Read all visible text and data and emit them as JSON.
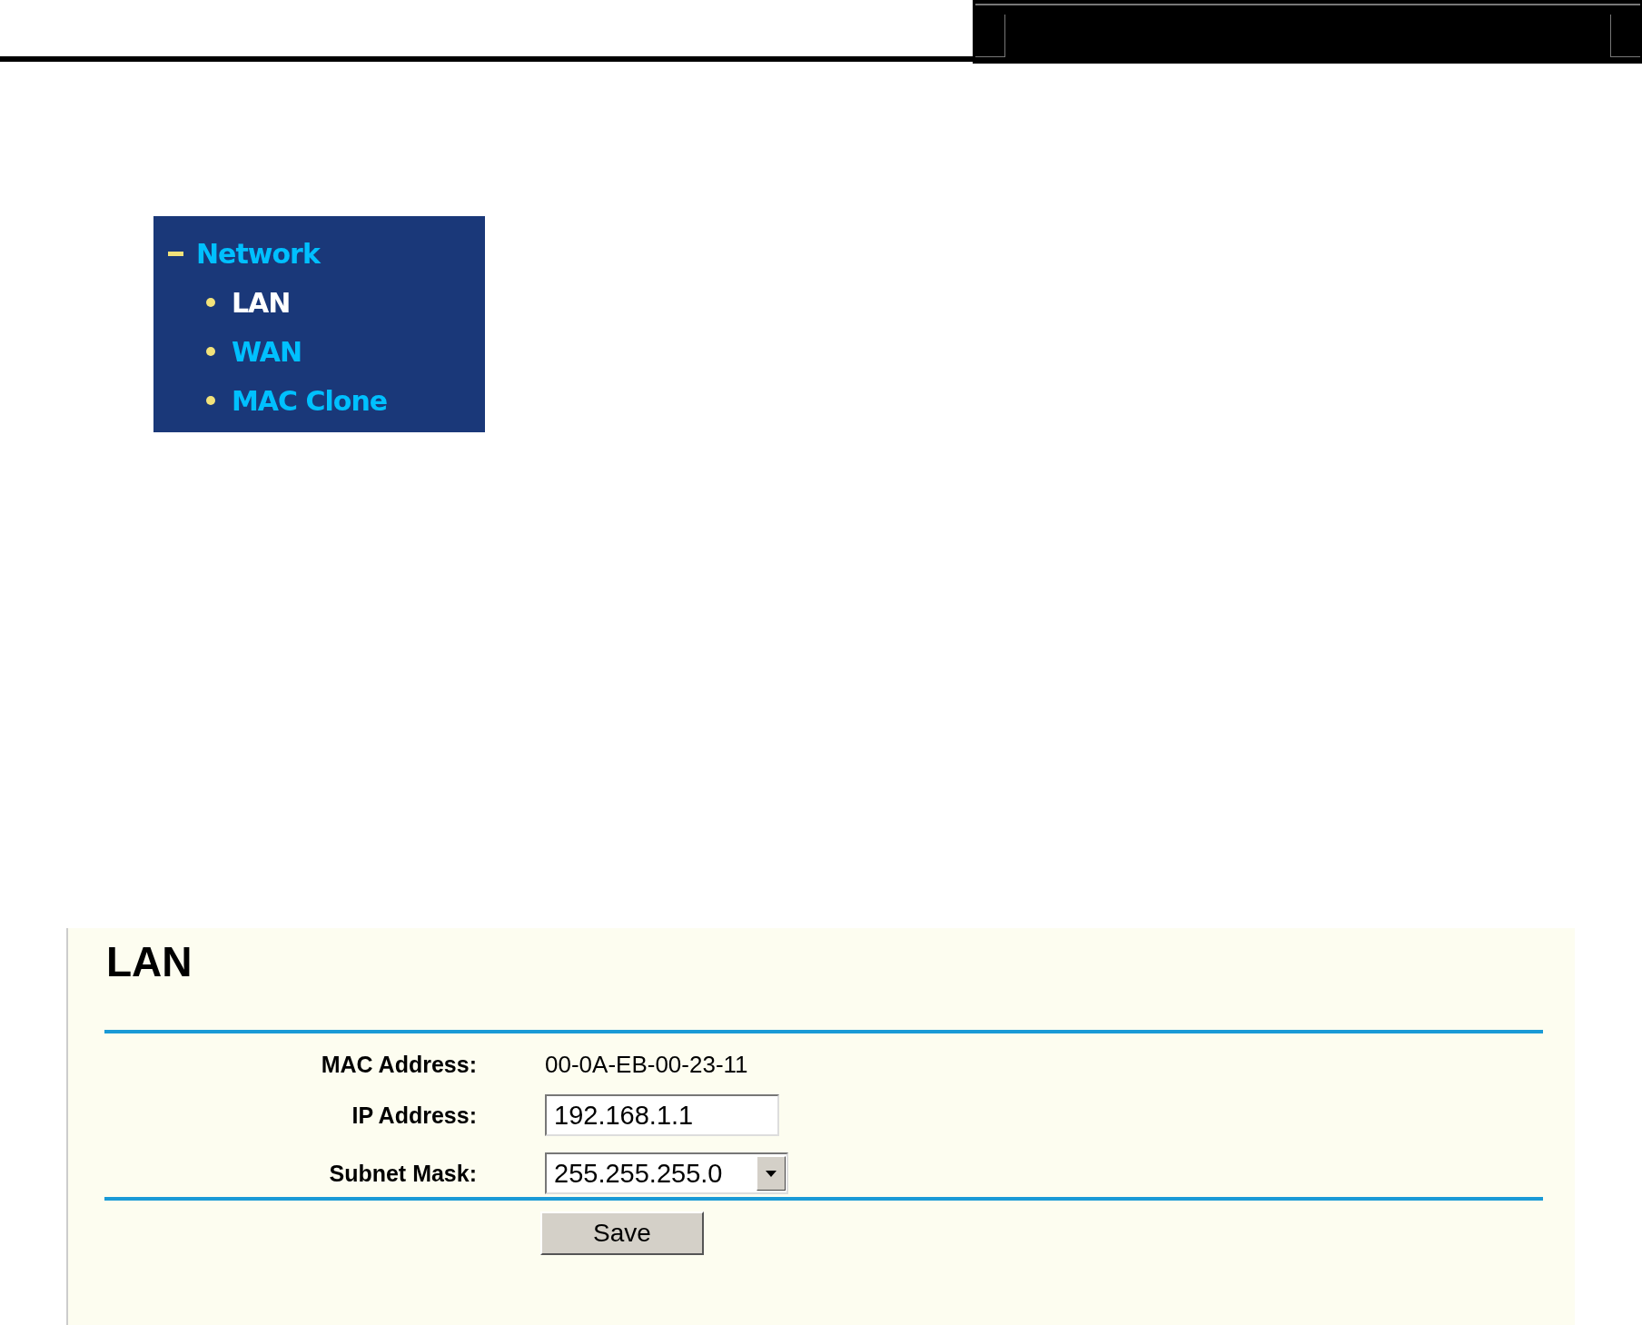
{
  "menu": {
    "group": {
      "label": "Network",
      "expanded": true
    },
    "items": [
      {
        "label": "LAN",
        "selected": true
      },
      {
        "label": "WAN",
        "selected": false
      },
      {
        "label": "MAC Clone",
        "selected": false
      }
    ]
  },
  "lan": {
    "title": "LAN",
    "fields": [
      {
        "kind": "text",
        "label": "MAC Address:",
        "value": "00-0A-EB-00-23-11"
      },
      {
        "kind": "input",
        "label": "IP Address:",
        "value": "192.168.1.1"
      },
      {
        "kind": "select",
        "label": "Subnet Mask:",
        "value": "255.255.255.0"
      }
    ],
    "button": "Save"
  }
}
